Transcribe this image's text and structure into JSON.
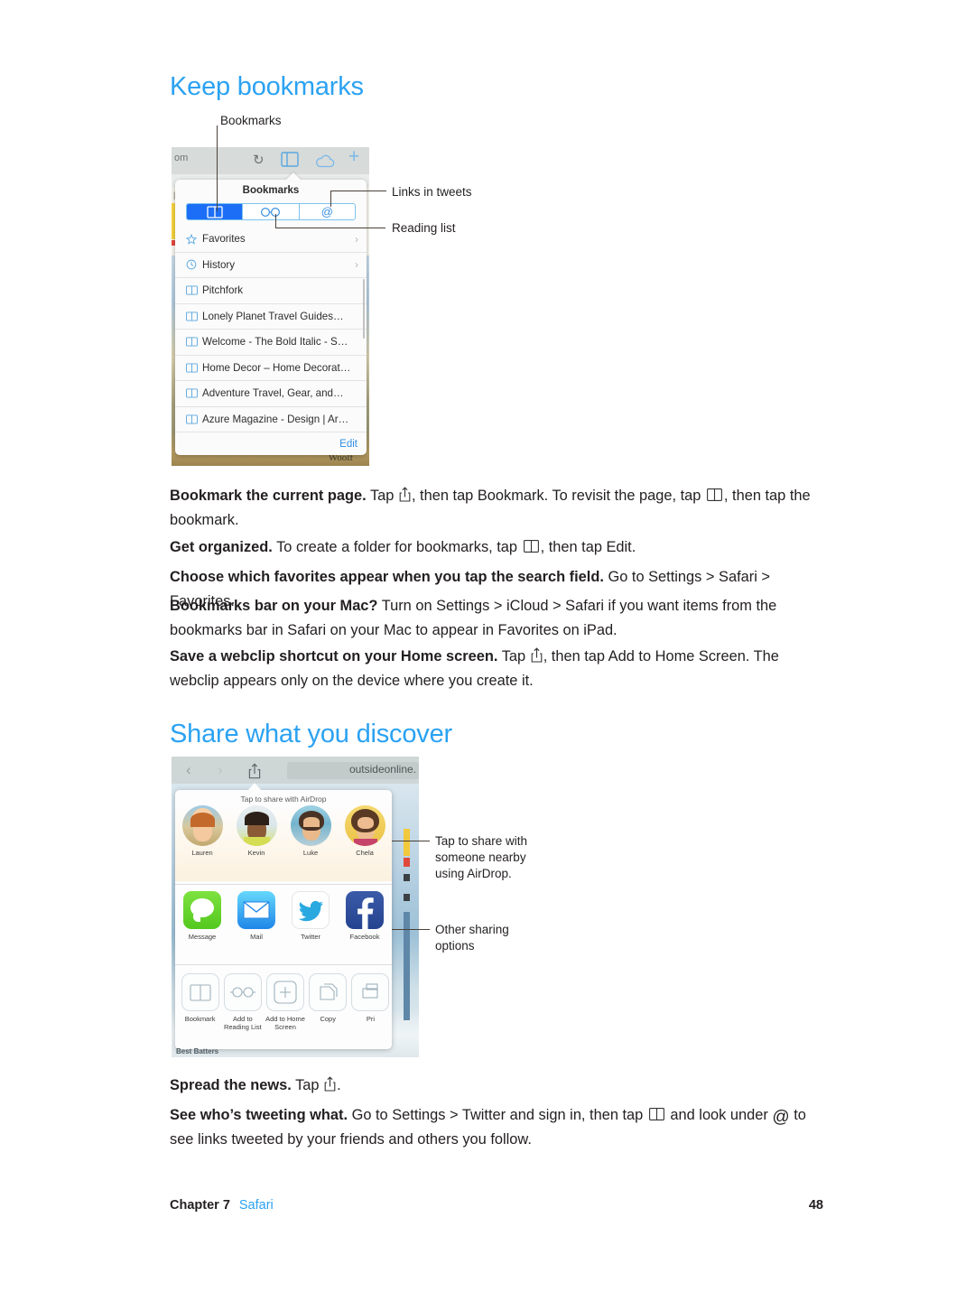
{
  "meta": {
    "accent_blue": "#2ba2f2",
    "text_color": "#231f20"
  },
  "sections": [
    {
      "id": "keep-bookmarks",
      "title": "Keep bookmarks"
    },
    {
      "id": "share-what-you-discover",
      "title": "Share what you discover"
    }
  ],
  "figure_bookmarks": {
    "callouts": [
      {
        "id": "bookmarks",
        "label": "Bookmarks"
      },
      {
        "id": "links-in-tweets",
        "label": "Links in tweets"
      },
      {
        "id": "reading-list",
        "label": "Reading list"
      }
    ],
    "browser_bar": {
      "url_fragment": "om",
      "reload_icon": "reload-icon",
      "bookmarks_icon": "bookmarks-icon",
      "cloud_icon": "icloud-tabs-icon",
      "add_tab_icon": "plus-icon"
    },
    "popover": {
      "title": "Bookmarks",
      "segments": [
        {
          "id": "bookmarks",
          "icon": "open-book-icon",
          "selected": true
        },
        {
          "id": "reading-list",
          "icon": "glasses-icon",
          "selected": false
        },
        {
          "id": "shared-links",
          "icon": "at-sign-icon",
          "selected": false
        }
      ],
      "items": [
        {
          "label": "Favorites",
          "icon": "star-icon",
          "chevron": true
        },
        {
          "label": "History",
          "icon": "clock-icon",
          "chevron": true
        },
        {
          "label": "Pitchfork",
          "icon": "book-icon",
          "chevron": false
        },
        {
          "label": "Lonely Planet Travel Guides…",
          "icon": "book-icon",
          "chevron": false
        },
        {
          "label": "Welcome - The Bold Italic - S…",
          "icon": "book-icon",
          "chevron": false
        },
        {
          "label": "Home Decor – Home Decorat…",
          "icon": "book-icon",
          "chevron": false
        },
        {
          "label": "Adventure Travel, Gear, and…",
          "icon": "book-icon",
          "chevron": false
        },
        {
          "label": "Azure Magazine - Design | Ar…",
          "icon": "book-icon",
          "chevron": false
        }
      ],
      "edit_label": "Edit"
    },
    "page_background": {
      "word_fragment": "Woolf"
    }
  },
  "body_keep": [
    {
      "id": "bookmark-the-current-page",
      "lead": "Bookmark the current page.",
      "parts": [
        {
          "t": "text",
          "v": " Tap "
        },
        {
          "t": "icon",
          "v": "share-icon"
        },
        {
          "t": "text",
          "v": ", then tap Bookmark. To revisit the page, tap "
        },
        {
          "t": "icon",
          "v": "bookmarks-icon"
        },
        {
          "t": "text",
          "v": ", then tap the bookmark."
        }
      ]
    },
    {
      "id": "get-organized",
      "lead": "Get organized.",
      "parts": [
        {
          "t": "text",
          "v": " To create a folder for bookmarks, tap "
        },
        {
          "t": "icon",
          "v": "bookmarks-icon"
        },
        {
          "t": "text",
          "v": ", then tap Edit."
        }
      ]
    },
    {
      "id": "choose-which-favorites",
      "lead": "Choose which favorites appear when you tap the search field.",
      "parts": [
        {
          "t": "text",
          "v": " Go to Settings > Safari > Favorites."
        }
      ]
    },
    {
      "id": "bookmarks-bar-on-your-mac",
      "lead": "Bookmarks bar on your Mac?",
      "parts": [
        {
          "t": "text",
          "v": " Turn on Settings > iCloud > Safari if you want items from the bookmarks bar in Safari on your Mac to appear in Favorites on iPad."
        }
      ]
    },
    {
      "id": "save-a-webclip-shortcut",
      "lead": "Save a webclip shortcut on your Home screen.",
      "parts": [
        {
          "t": "text",
          "v": " Tap "
        },
        {
          "t": "icon",
          "v": "share-icon"
        },
        {
          "t": "text",
          "v": ", then tap Add to Home Screen. The webclip appears only on the device where you create it."
        }
      ]
    }
  ],
  "figure_share": {
    "callouts": [
      {
        "id": "airdrop",
        "label": "Tap to share with someone nearby using AirDrop."
      },
      {
        "id": "other-sharing",
        "label": "Other sharing options"
      }
    ],
    "browser_bar": {
      "back_icon": "chevron-left-icon",
      "forward_icon": "chevron-right-icon",
      "share_icon": "share-icon",
      "url_text": "outsideonline."
    },
    "sheet": {
      "airdrop_hint": "Tap to share with AirDrop",
      "contacts": [
        {
          "name": "Lauren"
        },
        {
          "name": "Kevin"
        },
        {
          "name": "Luke"
        },
        {
          "name": "Chela"
        }
      ],
      "apps": [
        {
          "label": "Message",
          "icon": "messages-icon",
          "color": "#6ddc3e"
        },
        {
          "label": "Mail",
          "icon": "mail-icon",
          "color": "#2aa7f0"
        },
        {
          "label": "Twitter",
          "icon": "twitter-icon",
          "color": "#ffffff"
        },
        {
          "label": "Facebook",
          "icon": "facebook-icon",
          "color": "#2b54a8"
        }
      ],
      "actions": [
        {
          "label": "Bookmark",
          "icon": "open-book-icon"
        },
        {
          "label": "Add to Reading List",
          "icon": "glasses-icon"
        },
        {
          "label": "Add to Home Screen",
          "icon": "plus-icon"
        },
        {
          "label": "Copy",
          "icon": "copy-icon"
        },
        {
          "label": "Pri",
          "icon": "print-icon"
        }
      ]
    },
    "page_background": {
      "caption_fragment": "Best Batters"
    }
  },
  "body_share": [
    {
      "id": "spread-the-news",
      "lead": "Spread the news.",
      "parts": [
        {
          "t": "text",
          "v": " Tap "
        },
        {
          "t": "icon",
          "v": "share-icon"
        },
        {
          "t": "text",
          "v": "."
        }
      ]
    },
    {
      "id": "see-whos-tweeting-what",
      "lead": "See who’s tweeting what.",
      "parts": [
        {
          "t": "text",
          "v": " Go to Settings > Twitter and sign in, then tap "
        },
        {
          "t": "icon",
          "v": "bookmarks-icon"
        },
        {
          "t": "text",
          "v": " and look under "
        },
        {
          "t": "icon",
          "v": "at-sign-icon"
        },
        {
          "t": "text",
          "v": " to see links tweeted by your friends and others you follow."
        }
      ]
    }
  ],
  "footer": {
    "chapter": "Chapter  7",
    "section_link": "Safari",
    "page_number": "48"
  }
}
